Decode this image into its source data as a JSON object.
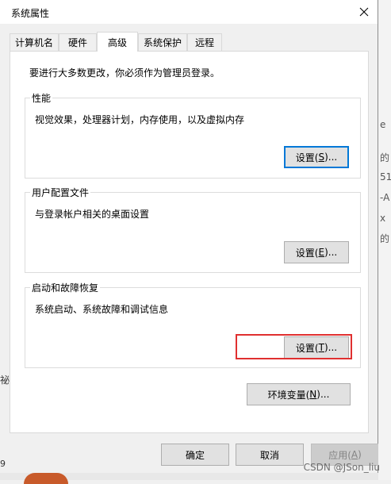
{
  "window": {
    "title": "系统属性",
    "close_icon": "close-icon"
  },
  "tabs": [
    {
      "label": "计算机名",
      "active": false
    },
    {
      "label": "硬件",
      "active": false
    },
    {
      "label": "高级",
      "active": true
    },
    {
      "label": "系统保护",
      "active": false
    },
    {
      "label": "远程",
      "active": false
    }
  ],
  "advanced": {
    "admin_note": "要进行大多数更改，你必须作为管理员登录。",
    "performance": {
      "legend": "性能",
      "desc": "视觉效果，处理器计划，内存使用，以及虚拟内存",
      "button_pre": "设置(",
      "button_key": "S",
      "button_post": ")..."
    },
    "user_profiles": {
      "legend": "用户配置文件",
      "desc": "与登录帐户相关的桌面设置",
      "button_pre": "设置(",
      "button_key": "E",
      "button_post": ")..."
    },
    "startup_recovery": {
      "legend": "启动和故障恢复",
      "desc": "系统启动、系统故障和调试信息",
      "button_pre": "设置(",
      "button_key": "T",
      "button_post": ")..."
    },
    "env_vars": {
      "button_pre": "环境变量(",
      "button_key": "N",
      "button_post": ")..."
    }
  },
  "footer": {
    "ok_label": "确定",
    "cancel_label": "取消",
    "apply_pre": "应用(",
    "apply_key": "A",
    "apply_post": ")"
  },
  "background": {
    "right_fragments": [
      "e",
      "的",
      "51",
      "-A",
      "x",
      "的"
    ],
    "left_fragment": "祕",
    "left_fragment2": "9",
    "watermark": "CSDN @JSon_liu"
  },
  "colors": {
    "highlight_border": "#e03030",
    "focus_border": "#0078d7"
  }
}
